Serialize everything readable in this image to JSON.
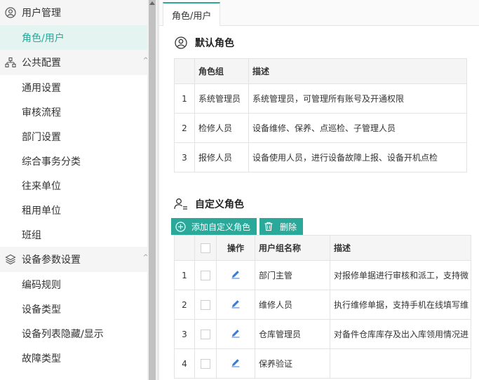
{
  "sidebar": {
    "groups": [
      {
        "label": "用户管理",
        "icon": "user-circle-icon",
        "items": [
          {
            "label": "角色/用户",
            "active": true
          }
        ]
      },
      {
        "label": "公共配置",
        "icon": "hierarchy-icon",
        "items": [
          {
            "label": "通用设置"
          },
          {
            "label": "审核流程"
          },
          {
            "label": "部门设置"
          },
          {
            "label": "综合事务分类"
          },
          {
            "label": "往来单位"
          },
          {
            "label": "租用单位"
          },
          {
            "label": "班组"
          }
        ]
      },
      {
        "label": "设备参数设置",
        "icon": "layers-icon",
        "items": [
          {
            "label": "编码规则"
          },
          {
            "label": "设备类型"
          },
          {
            "label": "设备列表隐藏/显示"
          },
          {
            "label": "故障类型"
          }
        ]
      }
    ]
  },
  "tab": {
    "label": "角色/用户"
  },
  "default_roles": {
    "title": "默认角色",
    "headers": [
      "",
      "角色组",
      "描述"
    ],
    "rows": [
      {
        "no": "1",
        "group": "系统管理员",
        "desc": "系统管理员，可管理所有账号及开通权限"
      },
      {
        "no": "2",
        "group": "检修人员",
        "desc": "设备维修、保养、点巡检、子管理人员"
      },
      {
        "no": "3",
        "group": "报修人员",
        "desc": "设备使用人员，进行设备故障上报、设备开机点检"
      }
    ]
  },
  "custom_roles": {
    "title": "自定义角色",
    "add_label": "添加自定义角色",
    "delete_label": "删除",
    "headers": [
      "",
      "",
      "操作",
      "用户组名称",
      "描述"
    ],
    "rows": [
      {
        "no": "1",
        "name": "部门主管",
        "desc": "对报修单据进行审核和派工，支持微"
      },
      {
        "no": "2",
        "name": "维修人员",
        "desc": "执行维修单据，支持手机在线填写维"
      },
      {
        "no": "3",
        "name": "仓库管理员",
        "desc": "对备件仓库库存及出入库领用情况进"
      },
      {
        "no": "4",
        "name": "保养验证",
        "desc": ""
      }
    ]
  },
  "colors": {
    "accent": "#2aa89a",
    "active_bg": "#e3f4f1",
    "edit_icon": "#3a7bd5"
  }
}
